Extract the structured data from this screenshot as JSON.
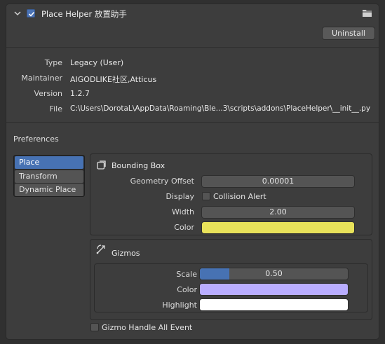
{
  "header": {
    "title": "Place Helper 放置助手",
    "uninstall_label": "Uninstall",
    "enabled": true
  },
  "info": [
    {
      "label": "Type",
      "value": "Legacy (User)"
    },
    {
      "label": "Maintainer",
      "value": "AIGODLIKE社区,Atticus"
    },
    {
      "label": "Version",
      "value": "1.2.7"
    },
    {
      "label": "File",
      "value": "C:\\Users\\DorotaL\\AppData\\Roaming\\Ble...3\\scripts\\addons\\PlaceHelper\\__init__.py"
    }
  ],
  "preferences": {
    "label": "Preferences",
    "tabs": [
      {
        "label": "Place",
        "active": true
      },
      {
        "label": "Transform",
        "active": false
      },
      {
        "label": "Dynamic Place",
        "active": false
      }
    ]
  },
  "bounding_box": {
    "title": "Bounding Box",
    "geometry_offset_label": "Geometry Offset",
    "geometry_offset_value": "0.00001",
    "display_label": "Display",
    "collision_alert_label": "Collision Alert",
    "collision_alert_checked": false,
    "width_label": "Width",
    "width_value": "2.00",
    "color_label": "Color",
    "color_hex": "#e8e25a"
  },
  "gizmos": {
    "title": "Gizmos",
    "scale_label": "Scale",
    "scale_value": "0.50",
    "scale_fill_fraction": 0.2,
    "color_label": "Color",
    "color_hex": "#b9adff",
    "highlight_label": "Highlight",
    "highlight_hex": "#ffffff",
    "handle_all_label": "Gizmo Handle All Event",
    "handle_all_checked": false
  },
  "colors": {
    "accent": "#4772b3",
    "panel_bg": "#3d3d3d",
    "window_bg": "#303030"
  },
  "icons": [
    "chevron-down-icon",
    "checkbox-icon",
    "folder-icon",
    "bounding-box-icon",
    "gizmo-icon"
  ]
}
